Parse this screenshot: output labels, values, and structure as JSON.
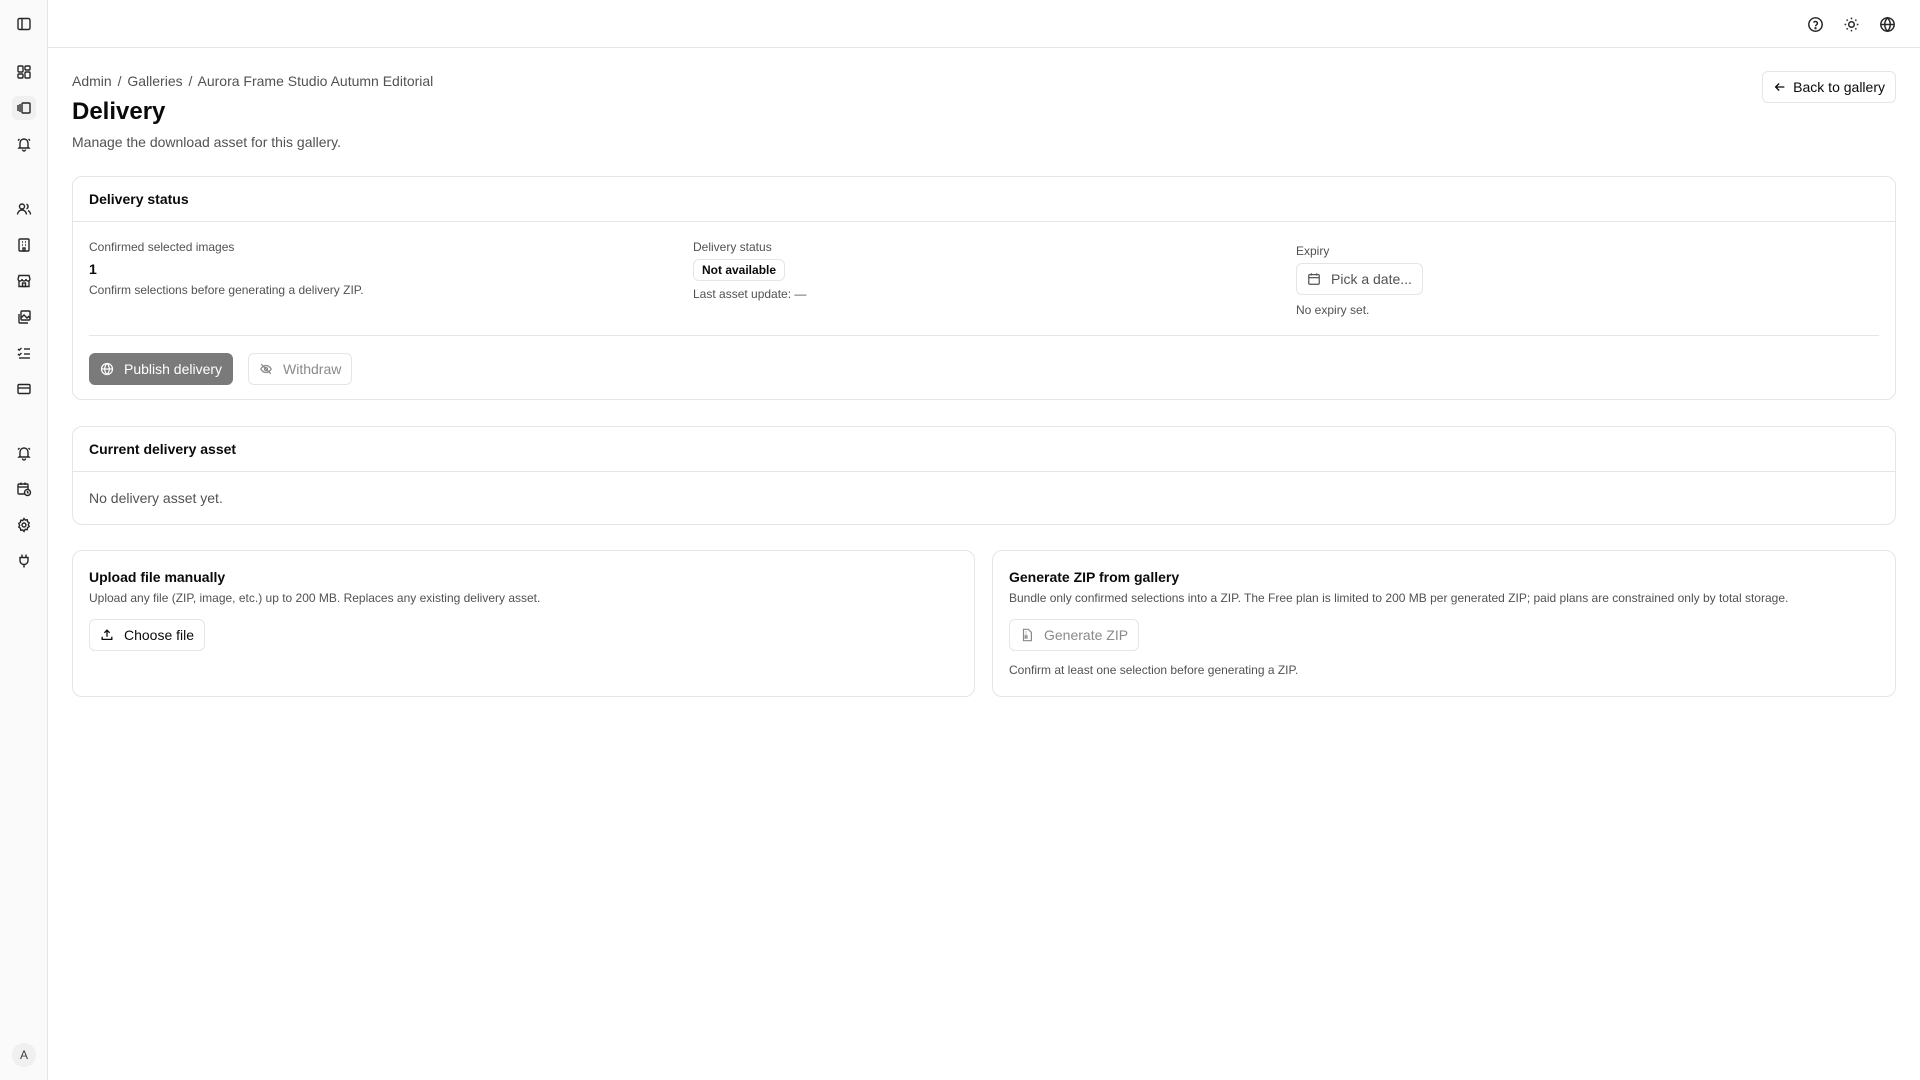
{
  "sidebar": {
    "items": [
      {
        "icon": "dashboard-icon"
      },
      {
        "icon": "galleries-icon"
      },
      {
        "icon": "notifications-icon"
      },
      {
        "icon": "clients-icon"
      },
      {
        "icon": "building-icon"
      },
      {
        "icon": "store-icon"
      },
      {
        "icon": "images-icon"
      },
      {
        "icon": "checklist-icon"
      },
      {
        "icon": "billing-icon"
      },
      {
        "icon": "alerts-icon"
      },
      {
        "icon": "schedule-icon"
      },
      {
        "icon": "settings-icon"
      },
      {
        "icon": "integrations-icon"
      }
    ],
    "avatar_initial": "A"
  },
  "topbar": {
    "icons": [
      "help-icon",
      "theme-sun-icon",
      "language-globe-icon"
    ]
  },
  "breadcrumb": {
    "items": [
      "Admin",
      "/",
      "Galleries",
      "/",
      "Aurora Frame Studio Autumn Editorial"
    ]
  },
  "page": {
    "title": "Delivery",
    "description": "Manage the download asset for this gallery.",
    "back_label": "Back to gallery"
  },
  "status_card": {
    "title": "Delivery status",
    "confirmed_label": "Confirmed selected images",
    "confirmed_value": "1",
    "confirmed_hint": "Confirm selections before generating a delivery ZIP.",
    "status_label": "Delivery status",
    "status_badge": "Not available",
    "last_update": "Last asset update: —",
    "expiry_label": "Expiry",
    "expiry_placeholder": "Pick a date...",
    "expiry_hint": "No expiry set.",
    "publish_label": "Publish delivery",
    "withdraw_label": "Withdraw"
  },
  "asset_card": {
    "title": "Current delivery asset",
    "empty": "No delivery asset yet."
  },
  "upload_card": {
    "title": "Upload file manually",
    "description": "Upload any file (ZIP, image, etc.) up to 200 MB. Replaces any existing delivery asset.",
    "button": "Choose file"
  },
  "zip_card": {
    "title": "Generate ZIP from gallery",
    "description": "Bundle only confirmed selections into a ZIP. The Free plan is limited to 200 MB per generated ZIP; paid plans are constrained only by total storage.",
    "button": "Generate ZIP",
    "hint": "Confirm at least one selection before generating a ZIP."
  }
}
